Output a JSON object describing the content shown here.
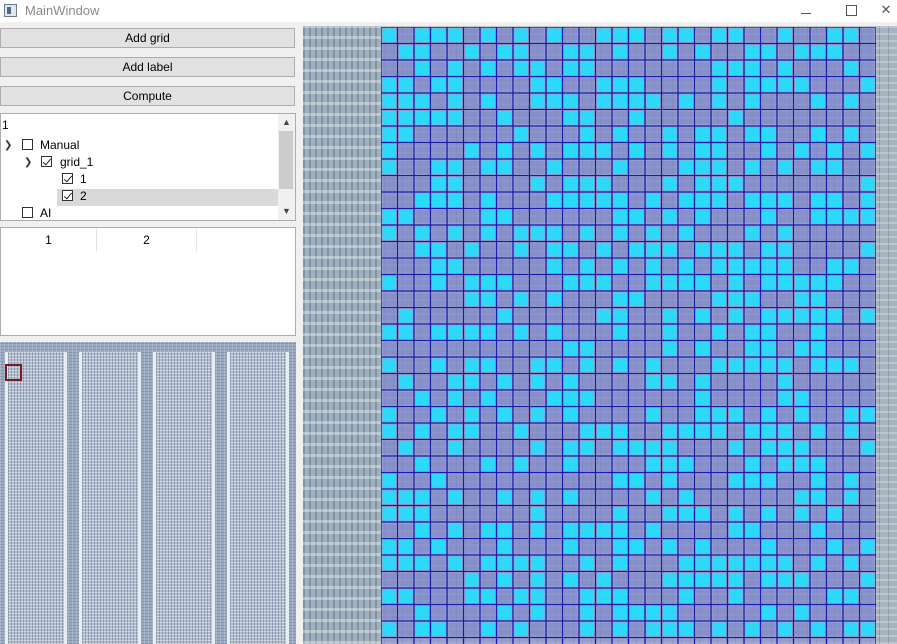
{
  "window": {
    "title": "MainWindow"
  },
  "buttons": {
    "add_grid": "Add grid",
    "add_label": "Add label",
    "compute": "Compute"
  },
  "tree": {
    "header": "1",
    "items": [
      {
        "label": "Manual",
        "checked": false,
        "expanded": true
      },
      {
        "label": "grid_1",
        "checked": true,
        "expanded": true
      },
      {
        "label": "1",
        "checked": true
      },
      {
        "label": "2",
        "checked": true,
        "selected": true
      },
      {
        "label": "AI",
        "checked": false
      }
    ]
  },
  "table": {
    "columns": [
      "1",
      "2"
    ]
  },
  "colors": {
    "grid_line": "#1a1aa8",
    "cell_highlight": "#19e3ff",
    "cell_base": "#8a8fd8",
    "roi_box": "#7a1a25"
  }
}
